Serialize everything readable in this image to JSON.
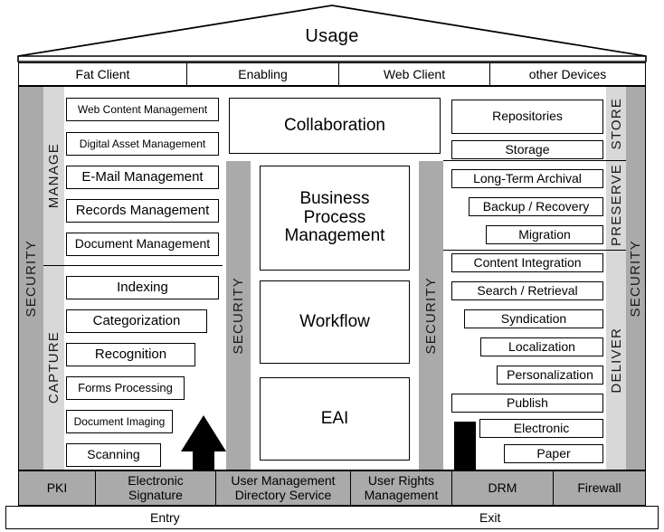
{
  "diagram": {
    "roof_label": "Usage",
    "accent_security_color": "#aaaaaa",
    "accent_zone_color": "#d8d8d8",
    "arrow_color": "#000000"
  },
  "usage_bar": {
    "cells": [
      {
        "label": "Fat Client"
      },
      {
        "label": "Enabling"
      },
      {
        "label": "Web Client"
      },
      {
        "label": "other Devices"
      }
    ]
  },
  "security_bands": {
    "left": "SECURITY",
    "middle_left": "SECURITY",
    "middle_right": "SECURITY",
    "right": "SECURITY"
  },
  "zones": {
    "manage": {
      "label": "MANAGE",
      "items": [
        {
          "label": "Web Content Management",
          "font": 12
        },
        {
          "label": "Digital Asset Management",
          "font": 12
        },
        {
          "label": "E-Mail Management",
          "font": 15
        },
        {
          "label": "Records Management",
          "font": 15
        },
        {
          "label": "Document Management",
          "font": 14
        }
      ]
    },
    "capture": {
      "label": "CAPTURE",
      "items": [
        {
          "label": "Indexing",
          "font": 15
        },
        {
          "label": "Categorization",
          "font": 15
        },
        {
          "label": "Recognition",
          "font": 15
        },
        {
          "label": "Forms Processing",
          "font": 13
        },
        {
          "label": "Document Imaging",
          "font": 12
        },
        {
          "label": "Scanning",
          "font": 14
        }
      ]
    },
    "store": {
      "label": "STORE",
      "items": [
        {
          "label": "Repositories",
          "font": 14
        },
        {
          "label": "Storage",
          "font": 14
        }
      ]
    },
    "preserve": {
      "label": "PRESERVE",
      "items": [
        {
          "label": "Long-Term Archival",
          "font": 14
        },
        {
          "label": "Backup / Recovery",
          "font": 14
        },
        {
          "label": "Migration",
          "font": 14
        }
      ]
    },
    "deliver": {
      "label": "DELIVER",
      "items": [
        {
          "label": "Content Integration",
          "font": 14
        },
        {
          "label": "Search / Retrieval",
          "font": 14
        },
        {
          "label": "Syndication",
          "font": 14
        },
        {
          "label": "Localization",
          "font": 14
        },
        {
          "label": "Personalization",
          "font": 14
        },
        {
          "label": "Publish",
          "font": 14
        },
        {
          "label": "Electronic",
          "font": 14
        },
        {
          "label": "Paper",
          "font": 14
        }
      ]
    }
  },
  "center_column": {
    "collaboration": "Collaboration",
    "bpm": "Business\nProcess\nManagement",
    "bpm_lines": [
      "Business",
      "Process",
      "Management"
    ],
    "workflow": "Workflow",
    "eai": "EAI"
  },
  "services_bar": {
    "cells": [
      {
        "label": "PKI",
        "lines": [
          "PKI"
        ]
      },
      {
        "label": "Electronic Signature",
        "lines": [
          "Electronic",
          "Signature"
        ]
      },
      {
        "label": "User Management Directory Service",
        "lines": [
          "User Management",
          "Directory Service"
        ]
      },
      {
        "label": "User Rights Management",
        "lines": [
          "User Rights",
          "Management"
        ]
      },
      {
        "label": "DRM",
        "lines": [
          "DRM"
        ]
      },
      {
        "label": "Firewall",
        "lines": [
          "Firewall"
        ]
      }
    ]
  },
  "entry_exit_bar": {
    "entry_label": "Entry",
    "exit_label": "Exit"
  },
  "arrows": {
    "up_arrow_name": "entry-flow-arrow-up",
    "down_arrow_name": "exit-flow-arrow-down"
  }
}
